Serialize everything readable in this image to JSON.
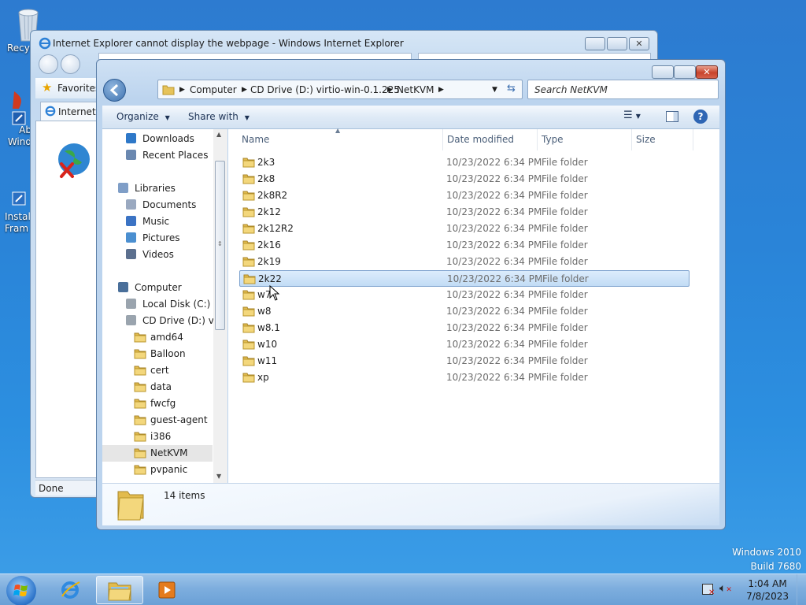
{
  "desktop": {
    "icons": [
      {
        "label": "Recyc",
        "icon": "recycle-bin-icon"
      },
      {
        "label": "Ab\nWind",
        "icon": "adobe-icon"
      },
      {
        "label": "Instal\nFram",
        "icon": "shortcut-icon"
      }
    ],
    "watermark": {
      "line1": "Windows 2010",
      "line2": "Build 7680"
    }
  },
  "ie_window": {
    "title": "Internet Explorer cannot display the webpage - Windows Internet Explorer",
    "favorites_label": "Favorites",
    "tab_label": "Internet E",
    "status": "Done"
  },
  "explorer": {
    "breadcrumb": [
      "Computer",
      "CD Drive (D:) virtio-win-0.1.225",
      "NetKVM"
    ],
    "search_placeholder": "Search NetKVM",
    "toolbar": {
      "organize": "Organize",
      "share_with": "Share with"
    },
    "nav": {
      "favorites": [
        "Downloads",
        "Recent Places"
      ],
      "libraries_label": "Libraries",
      "libraries": [
        "Documents",
        "Music",
        "Pictures",
        "Videos"
      ],
      "computer_label": "Computer",
      "drives": [
        "Local Disk (C:)",
        "CD Drive (D:) virt"
      ],
      "drive_d_folders": [
        "amd64",
        "Balloon",
        "cert",
        "data",
        "fwcfg",
        "guest-agent",
        "i386",
        "NetKVM",
        "pvpanic"
      ],
      "selected": "NetKVM"
    },
    "columns": {
      "name": "Name",
      "date": "Date modified",
      "type": "Type",
      "size": "Size"
    },
    "files": [
      {
        "name": "2k3",
        "date": "10/23/2022 6:34 PM",
        "type": "File folder"
      },
      {
        "name": "2k8",
        "date": "10/23/2022 6:34 PM",
        "type": "File folder"
      },
      {
        "name": "2k8R2",
        "date": "10/23/2022 6:34 PM",
        "type": "File folder"
      },
      {
        "name": "2k12",
        "date": "10/23/2022 6:34 PM",
        "type": "File folder"
      },
      {
        "name": "2k12R2",
        "date": "10/23/2022 6:34 PM",
        "type": "File folder"
      },
      {
        "name": "2k16",
        "date": "10/23/2022 6:34 PM",
        "type": "File folder"
      },
      {
        "name": "2k19",
        "date": "10/23/2022 6:34 PM",
        "type": "File folder"
      },
      {
        "name": "2k22",
        "date": "10/23/2022 6:34 PM",
        "type": "File folder"
      },
      {
        "name": "w7",
        "date": "10/23/2022 6:34 PM",
        "type": "File folder"
      },
      {
        "name": "w8",
        "date": "10/23/2022 6:34 PM",
        "type": "File folder"
      },
      {
        "name": "w8.1",
        "date": "10/23/2022 6:34 PM",
        "type": "File folder"
      },
      {
        "name": "w10",
        "date": "10/23/2022 6:34 PM",
        "type": "File folder"
      },
      {
        "name": "w11",
        "date": "10/23/2022 6:34 PM",
        "type": "File folder"
      },
      {
        "name": "xp",
        "date": "10/23/2022 6:34 PM",
        "type": "File folder"
      }
    ],
    "selected_file": "2k22",
    "item_count": "14 items"
  },
  "taskbar": {
    "time": "1:04 AM",
    "date": "7/8/2023"
  },
  "colors": {
    "accent": "#3399ff",
    "selection": "#c2dcf5",
    "desktop": "#2a84d8"
  }
}
